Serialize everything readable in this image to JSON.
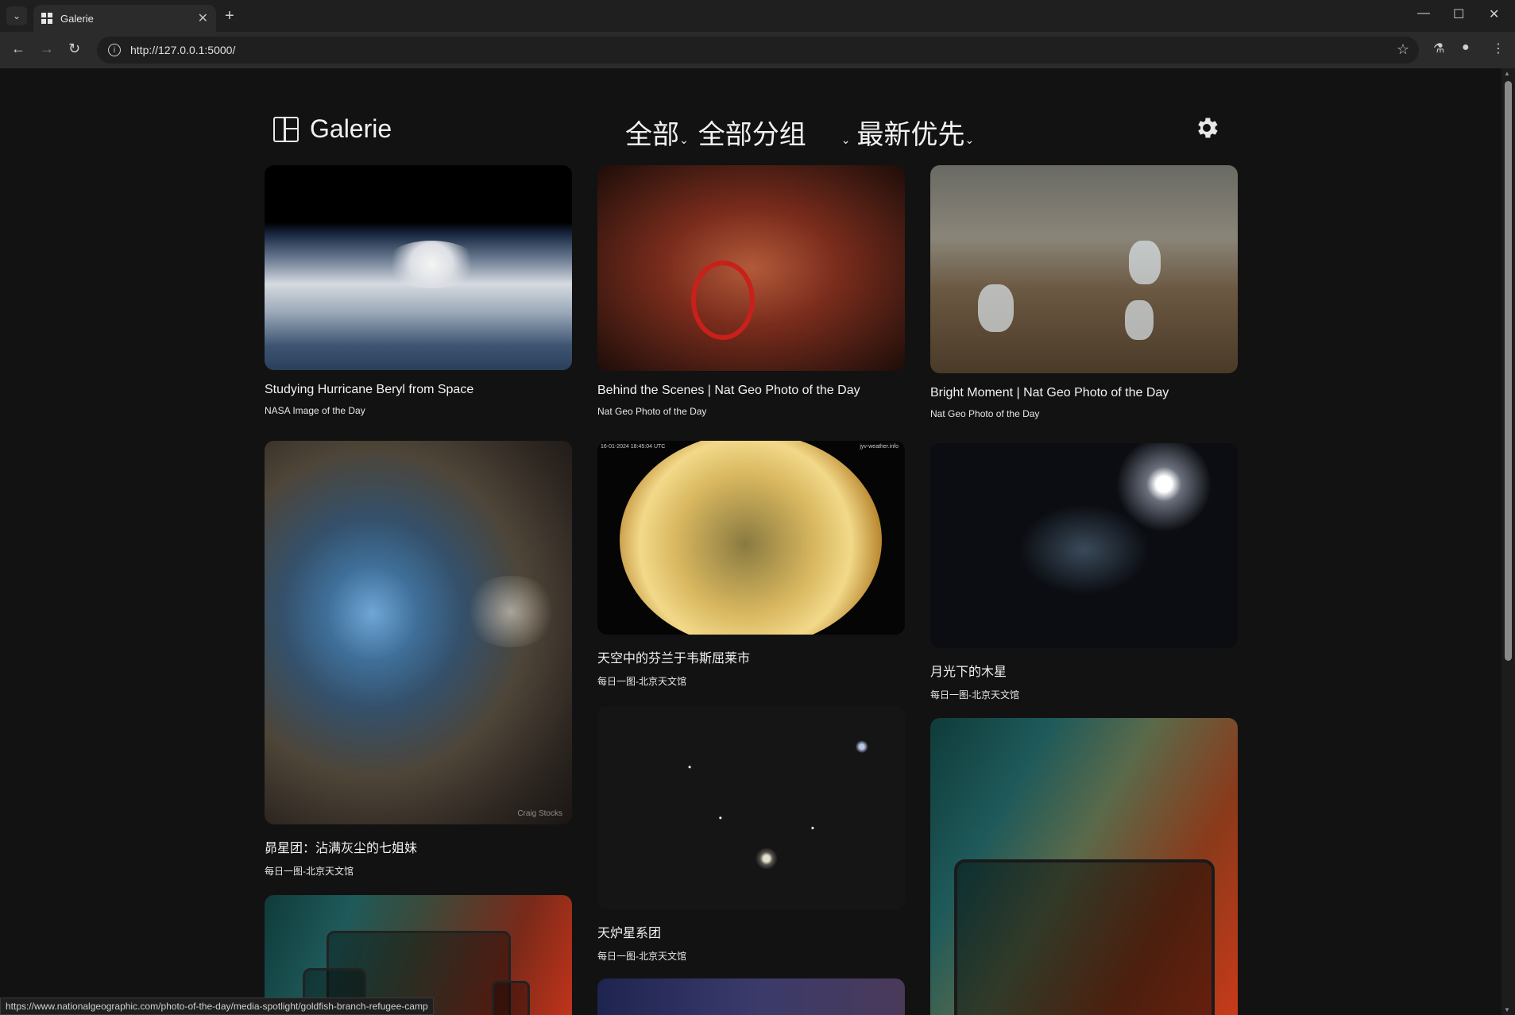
{
  "browser": {
    "tab_title": "Galerie",
    "url": "http://127.0.0.1:5000/",
    "status_url": "https://www.nationalgeographic.com/photo-of-the-day/media-spotlight/goldfish-branch-refugee-camp"
  },
  "header": {
    "app_name": "Galerie",
    "filter_all": "全部",
    "filter_group": "全部分组",
    "sort": "最新优先"
  },
  "cards": [
    {
      "title": "Studying Hurricane Beryl from Space",
      "source": "NASA Image of the Day"
    },
    {
      "title": "Behind the Scenes | Nat Geo Photo of the Day",
      "source": "Nat Geo Photo of the Day"
    },
    {
      "title": "Bright Moment | Nat Geo Photo of the Day",
      "source": "Nat Geo Photo of the Day"
    },
    {
      "title": "昴星团：沾满灰尘的七姐妹",
      "source": "每日一图-北京天文馆",
      "credit": "Craig Stocks"
    },
    {
      "title": "天空中的芬兰于韦斯屈莱市",
      "source": "每日一图-北京天文馆",
      "overlay_left": "16-01-2024 18:45:04 UTC",
      "overlay_right": "jyv-weather.info"
    },
    {
      "title": "月光下的木星",
      "source": "每日一图-北京天文馆"
    },
    {
      "title": "天炉星系团",
      "source": "每日一图-北京天文馆"
    }
  ],
  "colors": {
    "background": "#121212",
    "text": "#f2f2f2"
  }
}
